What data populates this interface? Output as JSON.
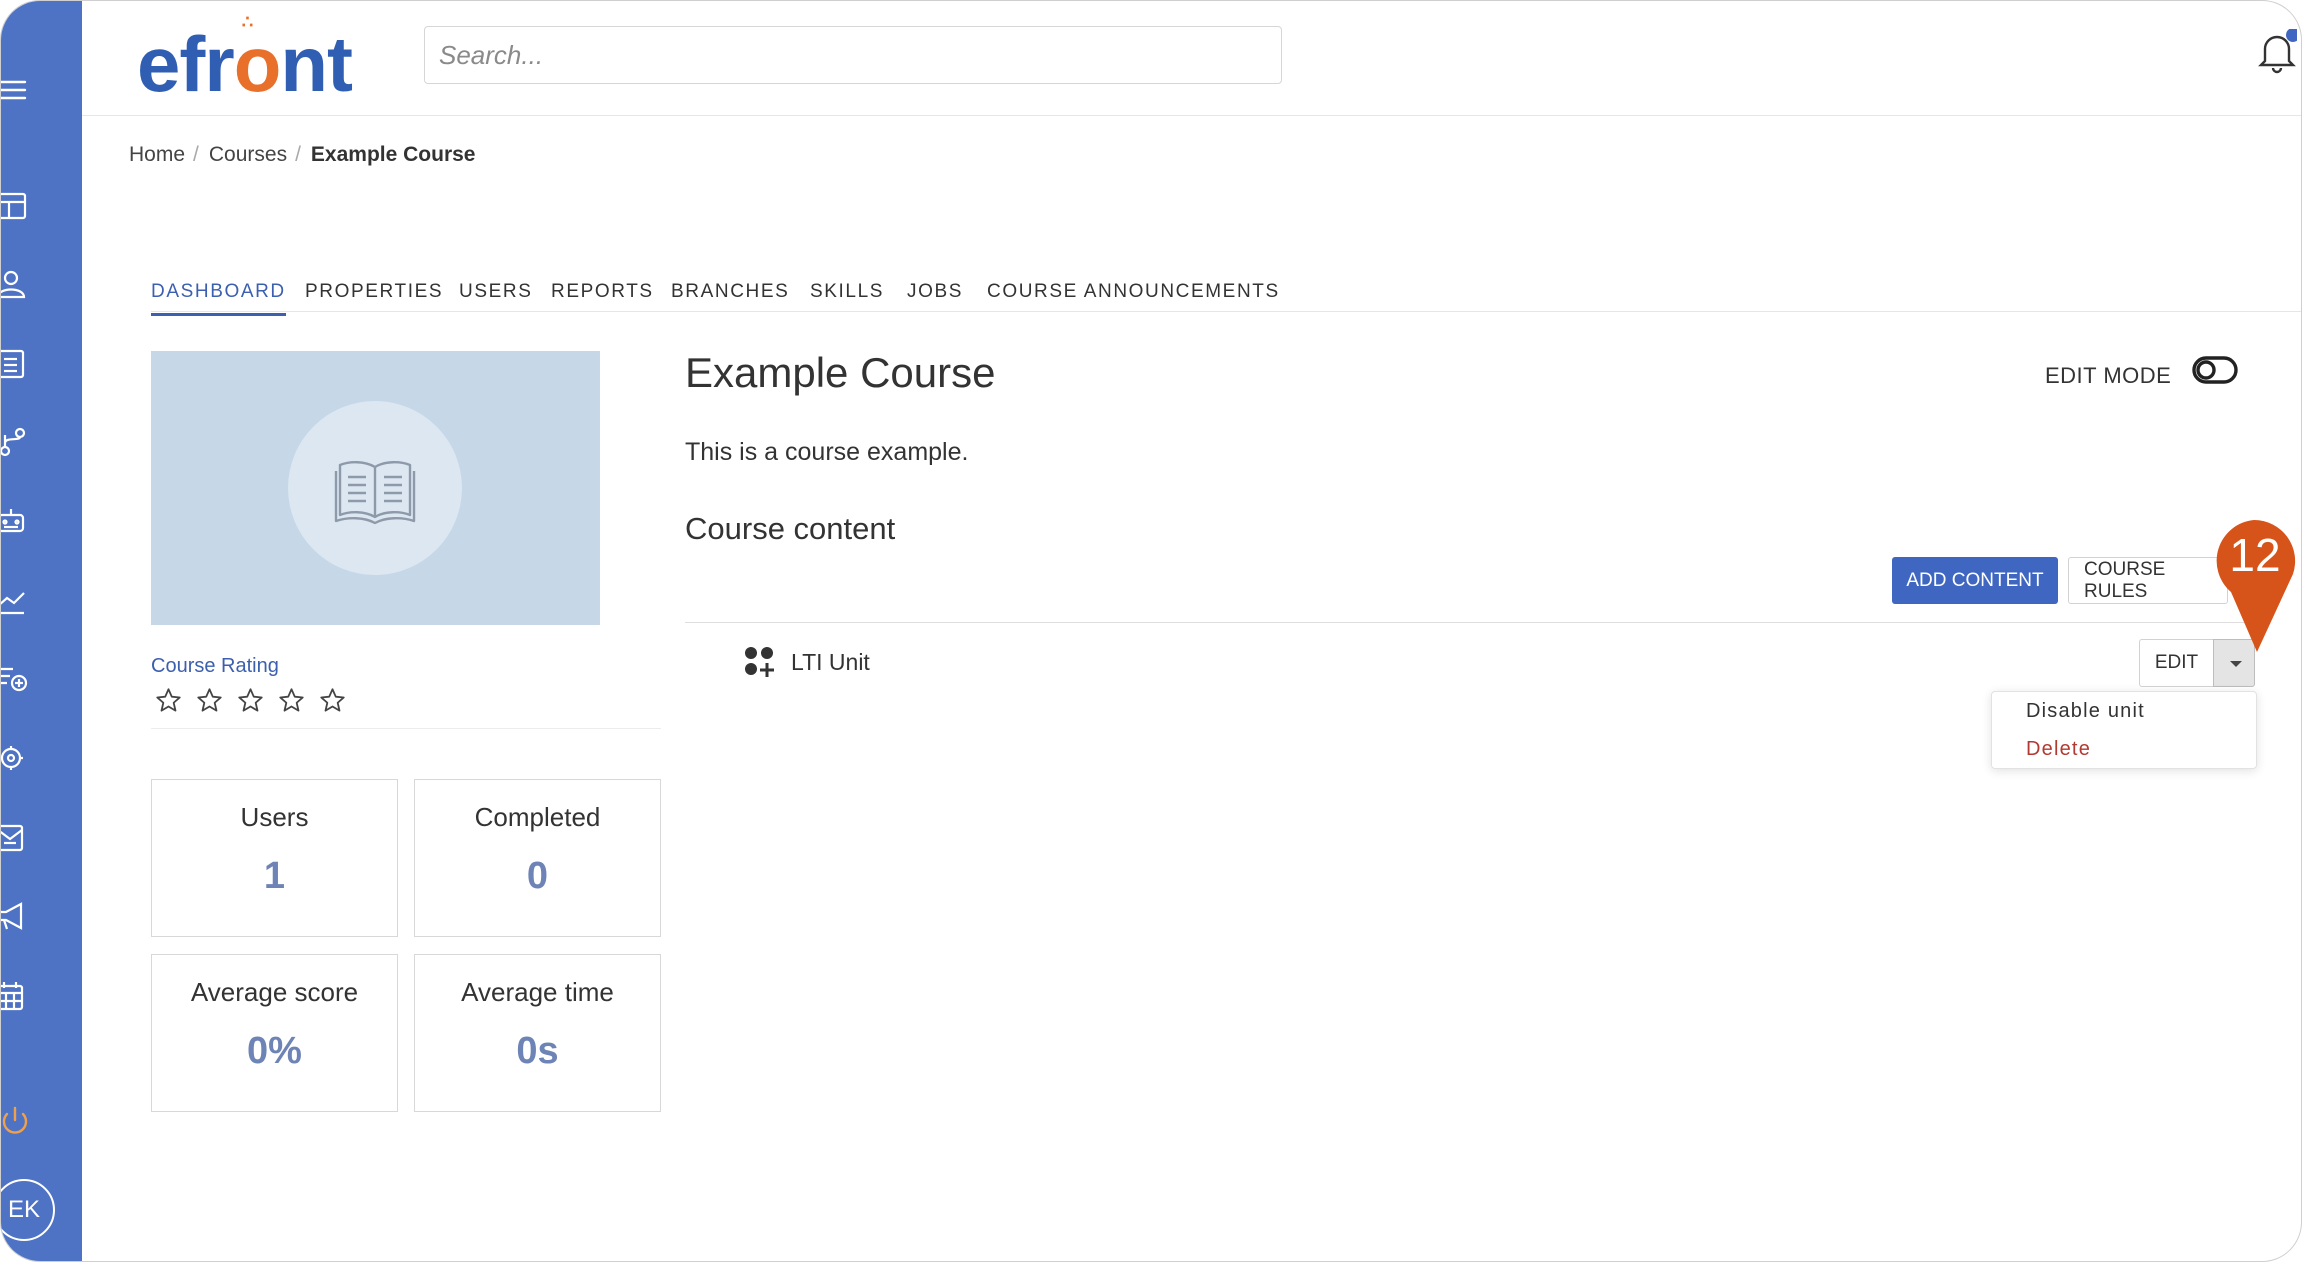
{
  "header": {
    "logo_text_a": "efr",
    "logo_text_o": "o",
    "logo_text_b": "nt",
    "search_placeholder": "Search..."
  },
  "sidebar": {
    "items": [
      {
        "icon": "menu-icon"
      },
      {
        "icon": "dashboard-icon"
      },
      {
        "icon": "user-icon"
      },
      {
        "icon": "courses-icon"
      },
      {
        "icon": "branches-icon"
      },
      {
        "icon": "automation-icon"
      },
      {
        "icon": "reports-icon"
      },
      {
        "icon": "add-course-icon"
      },
      {
        "icon": "settings-icon"
      },
      {
        "icon": "messages-icon"
      },
      {
        "icon": "announcements-icon"
      },
      {
        "icon": "calendar-icon"
      },
      {
        "icon": "power-icon"
      }
    ],
    "avatar_initials": "EK"
  },
  "breadcrumb": {
    "home": "Home",
    "courses": "Courses",
    "current": "Example Course",
    "separator": "/"
  },
  "tabs": [
    {
      "label": "DASHBOARD",
      "active": true
    },
    {
      "label": "PROPERTIES"
    },
    {
      "label": "USERS"
    },
    {
      "label": "REPORTS"
    },
    {
      "label": "BRANCHES"
    },
    {
      "label": "SKILLS"
    },
    {
      "label": "JOBS"
    },
    {
      "label": "COURSE ANNOUNCEMENTS"
    }
  ],
  "course": {
    "title": "Example Course",
    "description": "This is a course example.",
    "content_heading": "Course content",
    "rating_label": "Course Rating",
    "rating_value": 0,
    "rating_max": 5
  },
  "stats": [
    {
      "label": "Users",
      "value": "1"
    },
    {
      "label": "Completed",
      "value": "0"
    },
    {
      "label": "Average score",
      "value": "0%"
    },
    {
      "label": "Average time",
      "value": "0s"
    }
  ],
  "toolbar": {
    "edit_mode_label": "EDIT MODE",
    "add_content_label": "ADD CONTENT",
    "course_rules_label": "COURSE RULES"
  },
  "units": [
    {
      "label": "LTI Unit",
      "edit_label": "EDIT"
    }
  ],
  "unit_menu": {
    "disable_label": "Disable unit",
    "delete_label": "Delete"
  },
  "callout": {
    "number": "12",
    "color": "#d6541a"
  },
  "colors": {
    "sidebar": "#4f73c4",
    "primary": "#3f67c1",
    "accent_orange": "#e8702a",
    "stat_value": "#6f84b6",
    "delete_red": "#b23a33"
  }
}
